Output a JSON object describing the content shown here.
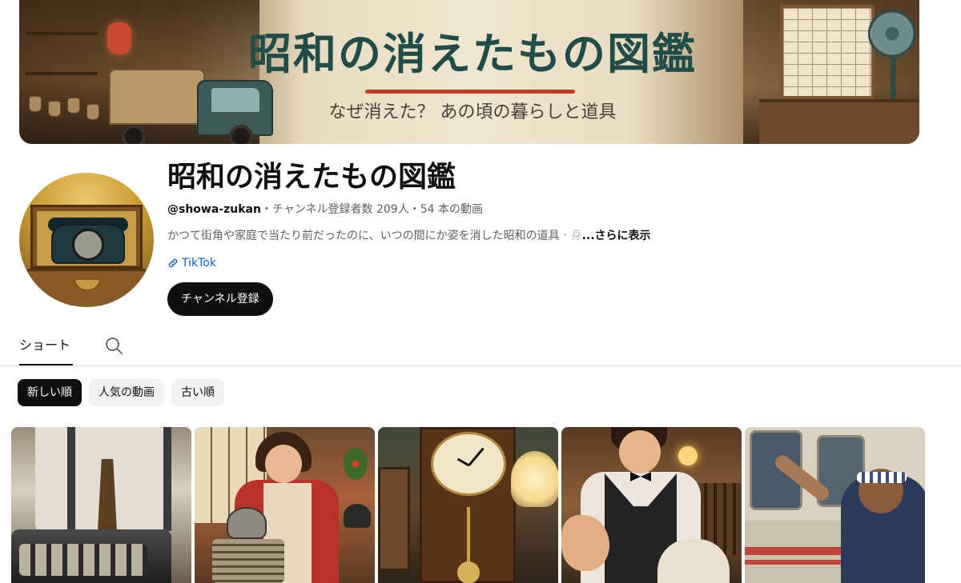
{
  "banner": {
    "title": "昭和の消えたもの図鑑",
    "subtitle": "なぜ消えた？ あの頃の暮らしと道具",
    "accent_color": "#c23b2b",
    "title_color": "#1f4d48"
  },
  "channel": {
    "name": "昭和の消えたもの図鑑",
    "handle": "@showa-zukan",
    "stats": "・チャンネル登録者数 209人・54 本の動画",
    "description": "かつて街角や家庭で当たり前だったのに、いつの間にか姿を消した昭和の道具",
    "description_fade": "・身",
    "more_label": "...さらに表示",
    "link_label": "TikTok",
    "link_icon": "link-icon",
    "subscribe_label": "チャンネル登録"
  },
  "tabs": {
    "items": [
      {
        "label": "ショート",
        "active": true
      }
    ],
    "search_icon": "search-icon"
  },
  "chips": [
    {
      "label": "新しい順",
      "active": true
    },
    {
      "label": "人気の動画",
      "active": false
    },
    {
      "label": "古い順",
      "active": false
    }
  ],
  "shorts": [
    {
      "subject": "cash-register-man"
    },
    {
      "subject": "woman-kettle-stove"
    },
    {
      "subject": "pendulum-clock"
    },
    {
      "subject": "waiter-reaching"
    },
    {
      "subject": "man-waving-train"
    }
  ],
  "colors": {
    "brand_dark": "#0f0f0f",
    "link": "#065fd4",
    "chip_bg": "#f2f2f2",
    "muted_text": "#606060"
  }
}
